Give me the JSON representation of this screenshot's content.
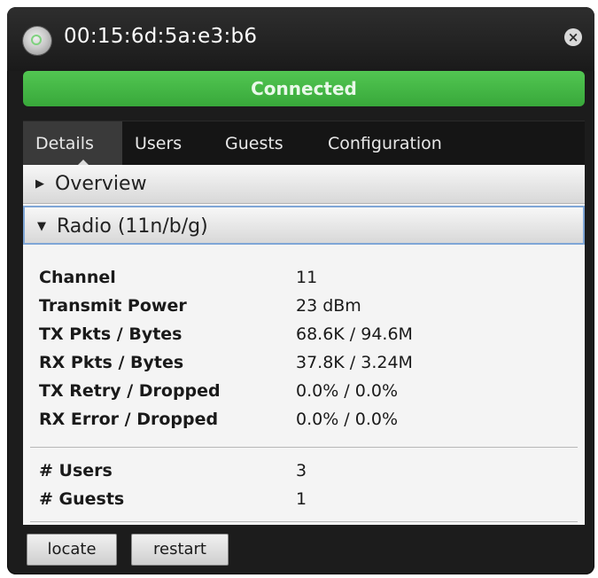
{
  "window": {
    "title": "00:15:6d:5a:e3:b6",
    "close_icon": "close-icon",
    "status_icon": "status-led-icon",
    "status_label": "Connected",
    "status_color": "#44b844"
  },
  "tabs": [
    {
      "label": "Details",
      "active": true
    },
    {
      "label": "Users"
    },
    {
      "label": "Guests"
    },
    {
      "label": "Configuration"
    }
  ],
  "sections": {
    "overview": {
      "label": "Overview",
      "expanded": false
    },
    "radio": {
      "label": "Radio (11n/b/g)",
      "expanded": true
    }
  },
  "radio_details": [
    {
      "key": "Channel",
      "value": "11"
    },
    {
      "key": "Transmit Power",
      "value": "23 dBm"
    },
    {
      "key": "TX Pkts / Bytes",
      "value": "68.6K / 94.6M"
    },
    {
      "key": "RX Pkts / Bytes",
      "value": "37.8K / 3.24M"
    },
    {
      "key": "TX Retry / Dropped",
      "value": "0.0% / 0.0%"
    },
    {
      "key": "RX Error / Dropped",
      "value": "0.0% / 0.0%"
    }
  ],
  "client_counts": [
    {
      "key": "# Users",
      "value": "3"
    },
    {
      "key": "# Guests",
      "value": "1"
    }
  ],
  "actions": {
    "locate_label": "locate",
    "restart_label": "restart"
  }
}
